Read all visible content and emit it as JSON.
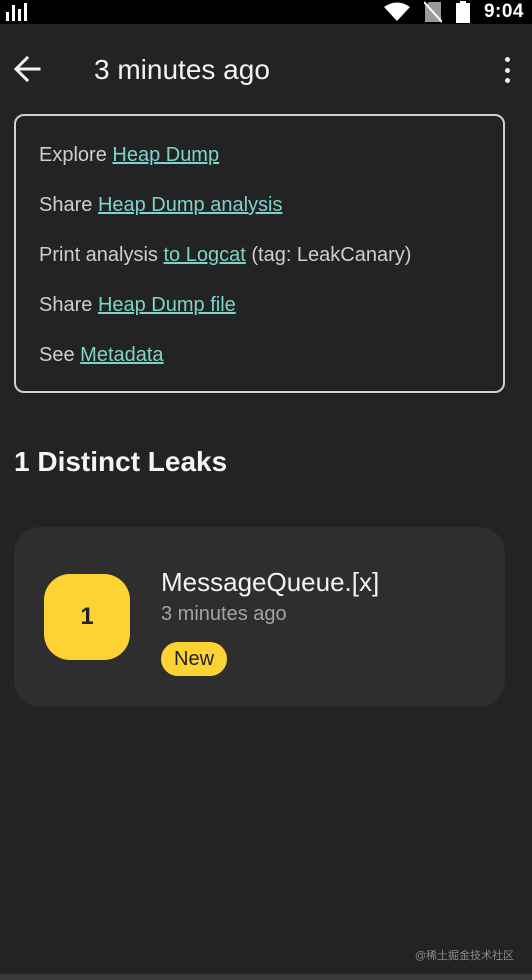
{
  "status_bar": {
    "time": "9:04",
    "icons": [
      "signal-icon",
      "wifi-icon",
      "no-sim-icon",
      "battery-icon"
    ]
  },
  "app_bar": {
    "title": "3 minutes ago",
    "back_icon": "arrow-left-icon",
    "menu_icon": "more-vert-icon"
  },
  "links": [
    {
      "prefix": "Explore ",
      "link": "Heap Dump",
      "suffix": ""
    },
    {
      "prefix": "Share ",
      "link": "Heap Dump analysis",
      "suffix": ""
    },
    {
      "prefix": "Print analysis ",
      "link": "to Logcat",
      "suffix": " (tag: LeakCanary)"
    },
    {
      "prefix": "Share ",
      "link": "Heap Dump file",
      "suffix": ""
    },
    {
      "prefix": "See ",
      "link": "Metadata",
      "suffix": ""
    }
  ],
  "section": {
    "title": "1 Distinct Leaks"
  },
  "leaks": [
    {
      "count": "1",
      "title": "MessageQueue.[x]",
      "time": "3 minutes ago",
      "badge": "New"
    }
  ],
  "watermark": "@稀土掘金技术社区",
  "colors": {
    "background": "#232323",
    "link": "#7fd3c8",
    "accent": "#fdd235",
    "card": "#2e2e2e"
  }
}
